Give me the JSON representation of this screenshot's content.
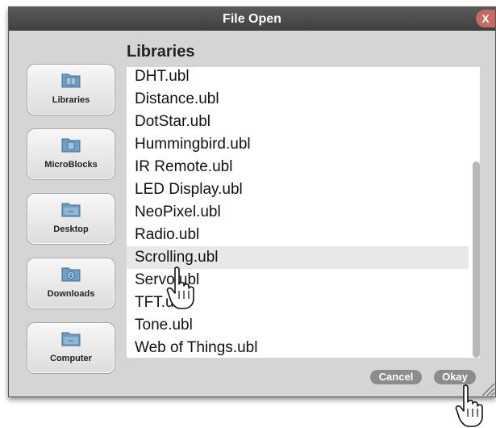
{
  "dialog": {
    "title": "File Open",
    "close_label": "X",
    "heading": "Libraries",
    "cancel_label": "Cancel",
    "okay_label": "Okay"
  },
  "locations": [
    {
      "label": "Libraries",
      "icon": "book-folder-icon"
    },
    {
      "label": "MicroBlocks",
      "icon": "microblocks-folder-icon"
    },
    {
      "label": "Desktop",
      "icon": "desktop-folder-icon"
    },
    {
      "label": "Downloads",
      "icon": "downloads-folder-icon"
    },
    {
      "label": "Computer",
      "icon": "computer-folder-icon"
    }
  ],
  "files": [
    "DHT.ubl",
    "Distance.ubl",
    "DotStar.ubl",
    "Hummingbird.ubl",
    "IR Remote.ubl",
    "LED Display.ubl",
    "NeoPixel.ubl",
    "Radio.ubl",
    "Scrolling.ubl",
    "Servo.ubl",
    "TFT.ubl",
    "Tone.ubl",
    "Web of Things.ubl"
  ],
  "selected_file": "Scrolling.ubl",
  "colors": {
    "title_bar": "#4a4a4a",
    "close_button": "#c56a60",
    "dialog_bg": "#d5d5d5",
    "button": "#8c8c8c",
    "selection": "#e8e8e8"
  }
}
